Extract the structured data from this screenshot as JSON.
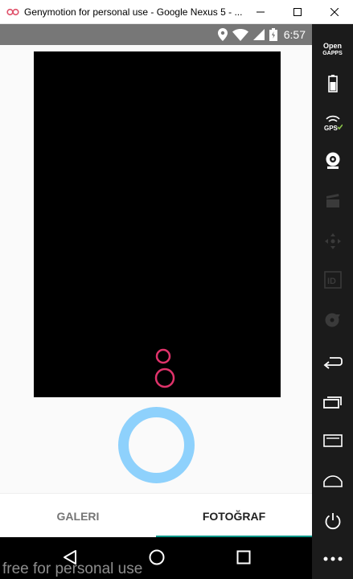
{
  "window": {
    "title": "Genymotion for personal use - Google Nexus 5 - ...",
    "minimize_icon": "minimize-icon",
    "maximize_icon": "maximize-icon",
    "close_icon": "close-icon"
  },
  "status_bar": {
    "time": "6:57",
    "icons": [
      "location-icon",
      "wifi-icon",
      "signal-icon",
      "battery-icon"
    ]
  },
  "camera": {
    "preview_icon": "camera-switch-icon",
    "shutter_color": "#8ed1fc"
  },
  "tabs": [
    {
      "label": "GALERI",
      "selected": false
    },
    {
      "label": "FOTOĞRAF",
      "selected": true
    }
  ],
  "tab_indicator_color": "#009688",
  "nav_bar": {
    "icons": [
      "back-icon",
      "home-icon",
      "recent-apps-icon"
    ]
  },
  "watermark": "free for personal use",
  "sidebar": {
    "opengapps_line1": "Open",
    "opengapps_line2": "GAPPS",
    "gps_label": "GPS",
    "id_label": "ID",
    "items": [
      "opengapps-icon",
      "battery-icon",
      "gps-icon",
      "webcam-icon",
      "capture-icon",
      "dpad-icon",
      "id-icon",
      "disk-icon",
      "back-icon",
      "recent-apps-icon",
      "menu-icon",
      "home-icon",
      "power-icon",
      "more-icon"
    ]
  }
}
